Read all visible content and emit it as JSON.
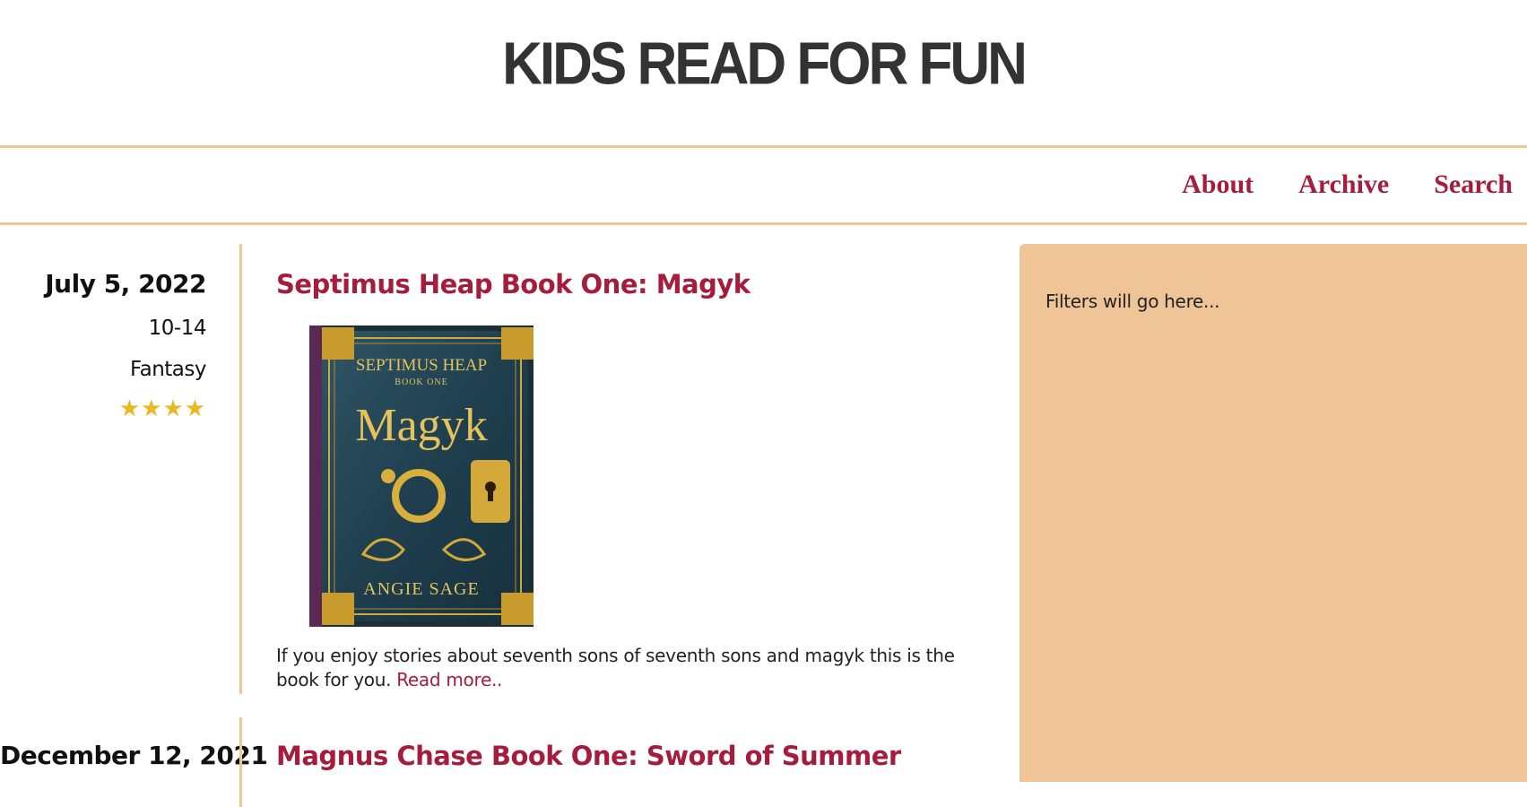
{
  "site": {
    "title": "KIDS READ FOR FUN"
  },
  "nav": {
    "items": [
      {
        "label": "About"
      },
      {
        "label": "Archive"
      },
      {
        "label": "Search"
      }
    ]
  },
  "posts": [
    {
      "date": "July 5, 2022",
      "age_range": "10-14",
      "genre": "Fantasy",
      "rating": 4,
      "rating_max": 4,
      "title": "Septimus Heap Book One: Magyk",
      "cover": {
        "series": "SEPTIMUS HEAP",
        "book": "BOOK ONE",
        "title": "Magyk",
        "author": "ANGIE SAGE"
      },
      "excerpt": "If you enjoy stories about seventh sons of seventh sons and magyk this is the book for you.",
      "read_more": "Read more.."
    },
    {
      "date": "December 12, 2021",
      "title": "Magnus Chase Book One: Sword of Summer"
    }
  ],
  "sidebar": {
    "text": "Filters will go here..."
  },
  "colors": {
    "accent": "#a61c3c",
    "border": "#efc697",
    "sidebar_bg": "#efc497",
    "star": "#e8b923"
  }
}
